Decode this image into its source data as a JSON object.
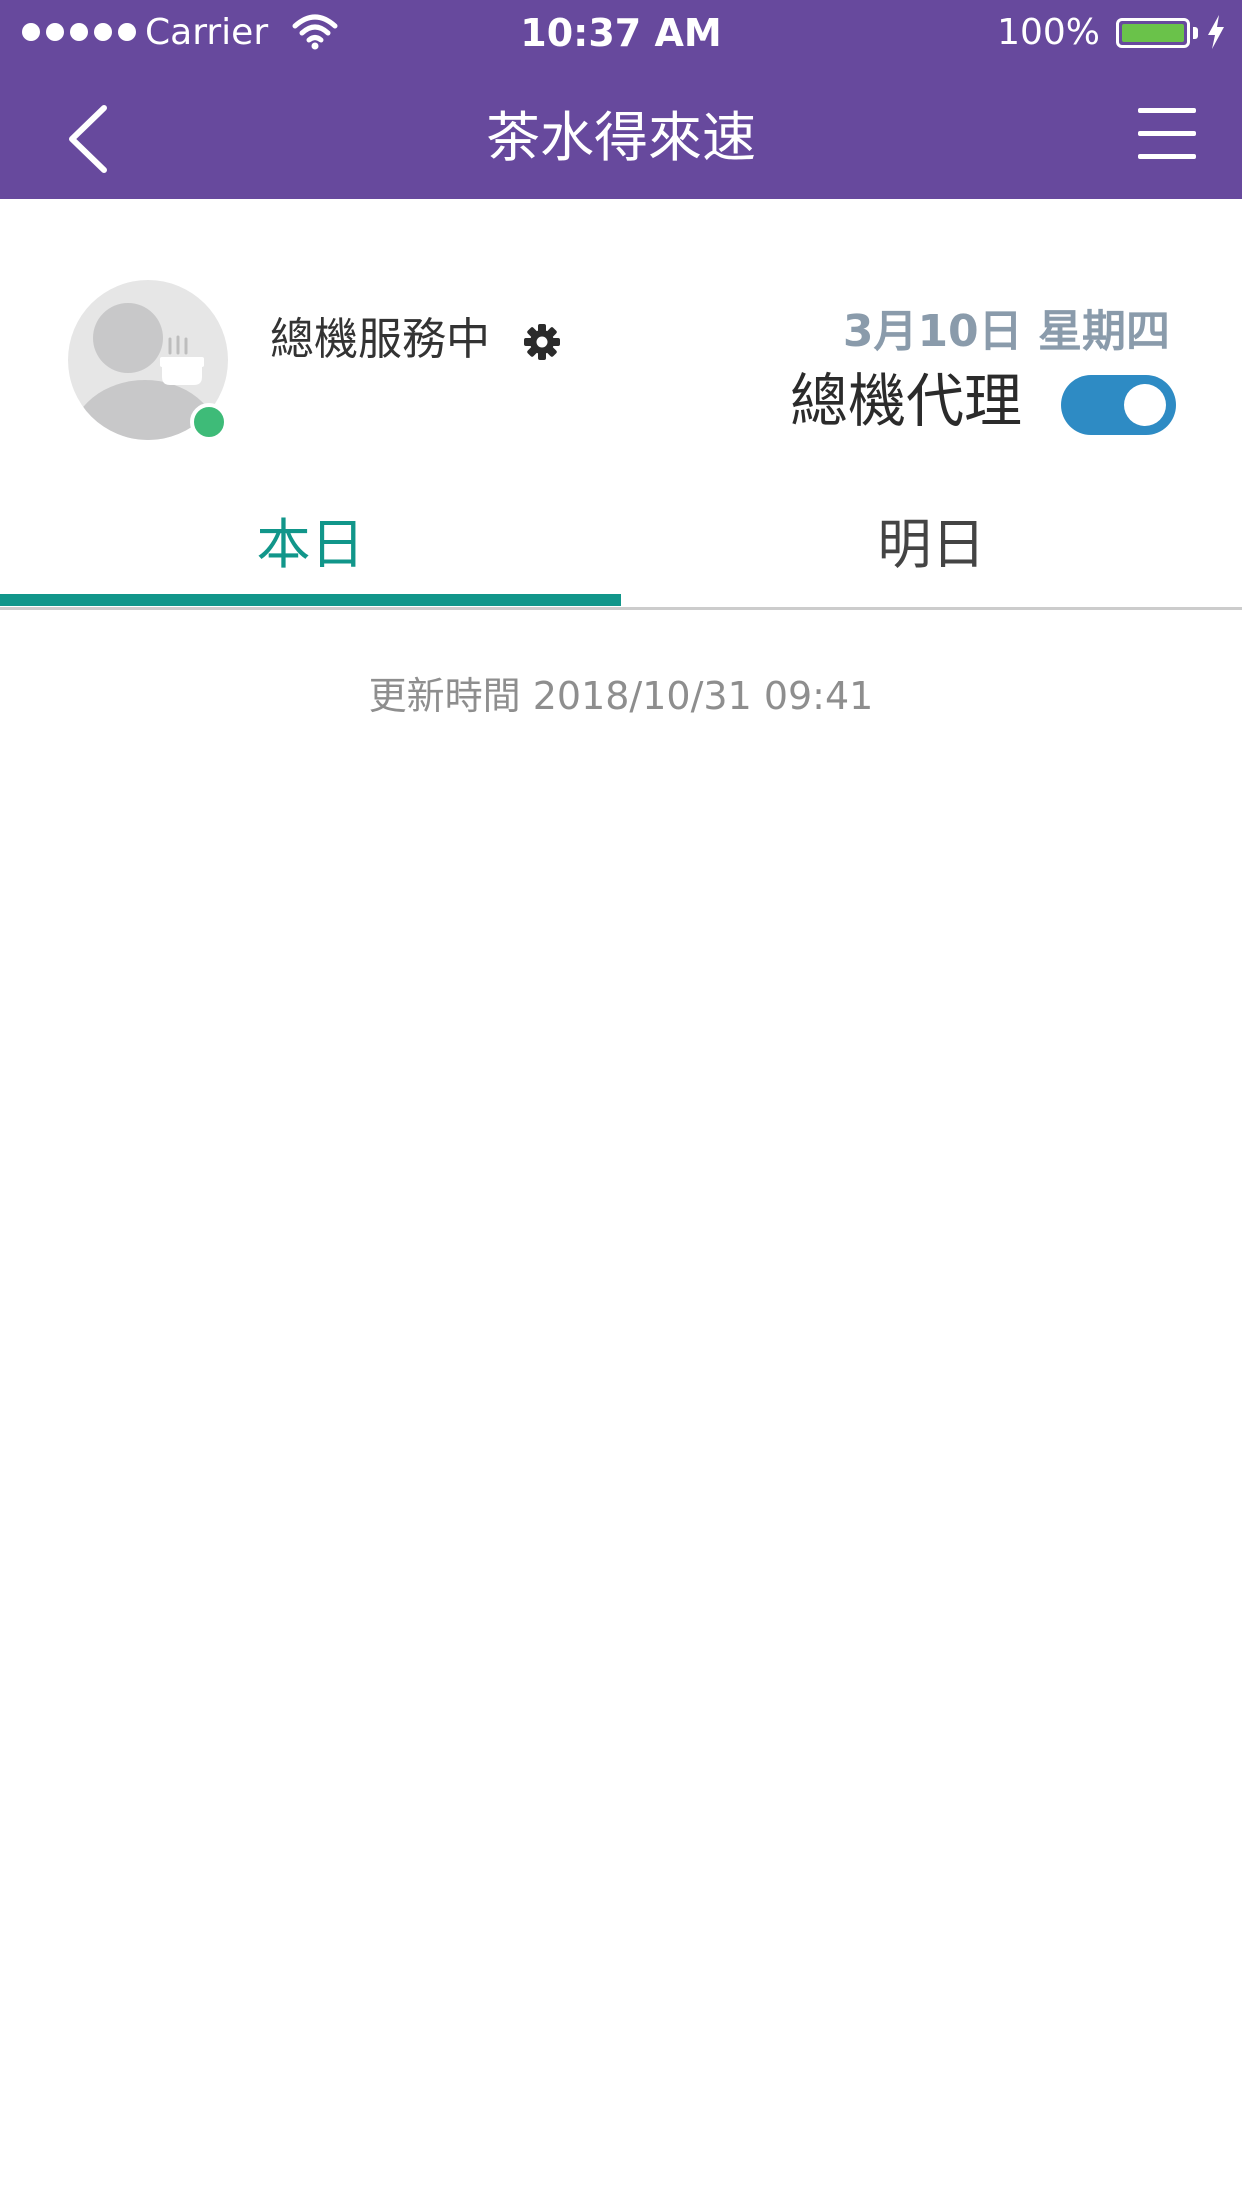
{
  "status_bar": {
    "carrier": "Carrier",
    "time": "10:37 AM",
    "battery": "100%",
    "signal_icon": "signal-dots-icon",
    "wifi_icon": "wifi-icon",
    "battery_icon": "battery-icon",
    "charging_icon": "charging-bolt-icon"
  },
  "nav": {
    "title": "茶水得來速",
    "back_icon": "chevron-left-icon",
    "menu_icon": "hamburger-menu-icon",
    "background_color": "#67499d"
  },
  "profile": {
    "status_text": "總機服務中",
    "settings_icon": "gear-icon",
    "online_color": "#3ebb78",
    "date": "3月10日 星期四",
    "proxy_label": "總機代理",
    "proxy_enabled": true,
    "toggle_color": "#2e8bc4"
  },
  "tabs": [
    {
      "label": "本日",
      "selected": true
    },
    {
      "label": "明日",
      "selected": false
    }
  ],
  "tab_accent_color": "#11968a",
  "update_time": "更新時間 2018/10/31 09:41"
}
